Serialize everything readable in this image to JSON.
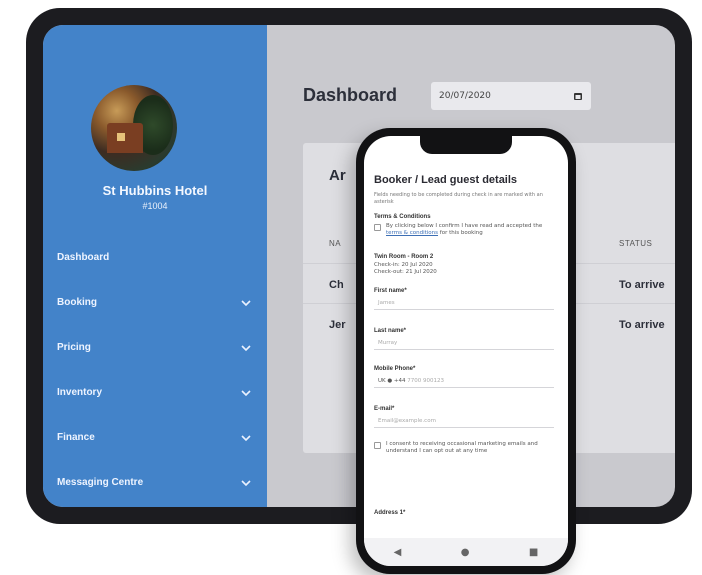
{
  "hotel": {
    "name": "St Hubbins Hotel",
    "id": "#1004"
  },
  "sidebar": {
    "items": [
      {
        "label": "Dashboard",
        "expandable": false
      },
      {
        "label": "Booking",
        "expandable": true
      },
      {
        "label": "Pricing",
        "expandable": true
      },
      {
        "label": "Inventory",
        "expandable": true
      },
      {
        "label": "Finance",
        "expandable": true
      },
      {
        "label": "Messaging Centre",
        "expandable": true
      }
    ]
  },
  "dashboard": {
    "title": "Dashboard",
    "date": "20/07/2020",
    "card_title": "Ar",
    "column_name": "NA",
    "column_status": "STATUS",
    "rows": [
      {
        "name": "Ch",
        "status": "To arrive"
      },
      {
        "name": "Jer",
        "status": "To arrive"
      }
    ]
  },
  "phone": {
    "title": "Booker / Lead guest details",
    "subtitle": "Fields needing to be completed during check in are marked with an asterisk",
    "terms_heading": "Terms & Conditions",
    "terms_text_before": "By clicking below I confirm I have read and accepted the ",
    "terms_link": "terms & conditions",
    "terms_text_after": " for this booking",
    "room_line": "Twin Room - Room 2",
    "checkin_line": "Check-in: 20 Jul 2020",
    "checkout_line": "Check-out: 21 Jul 2020",
    "first_name_label": "First name*",
    "first_name_value": "James",
    "last_name_label": "Last name*",
    "last_name_value": "Murray",
    "mobile_label": "Mobile Phone*",
    "mobile_prefix": "UK ● +44",
    "mobile_value": "7700 900123",
    "email_label": "E-mail*",
    "email_value": "Email@example.com",
    "marketing_text": "I consent to receiving occasional marketing emails and understand I can opt out at any time",
    "address_label": "Address 1*",
    "nav_back": "◀",
    "nav_home": "●",
    "nav_menu": "■"
  },
  "colors": {
    "sidebar": "#4383c9",
    "tablet_bezel": "#1c1c20",
    "content_bg": "#c9c9ce",
    "link": "#3d6fb5"
  }
}
